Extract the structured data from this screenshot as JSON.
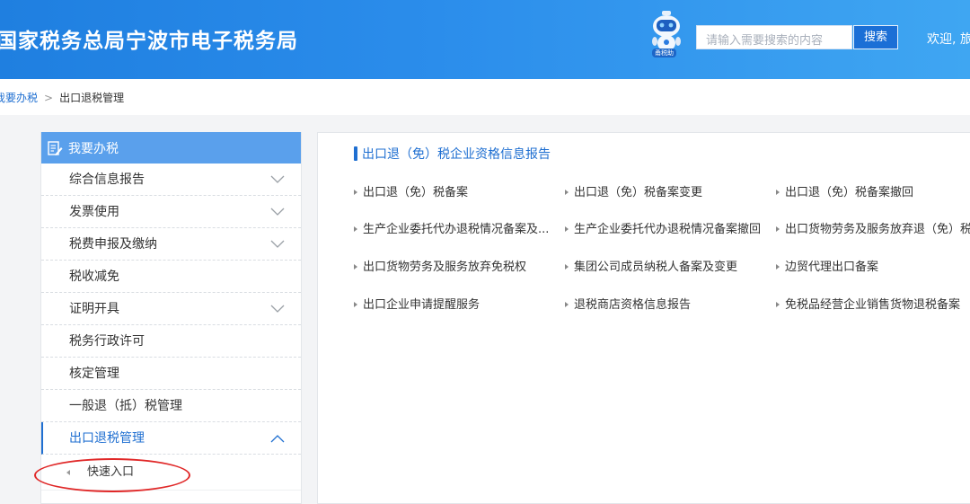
{
  "header": {
    "title": "国家税务总局宁波市电子税务局",
    "robot_caption": "甬税助",
    "search_placeholder": "请输入需要搜索的内容",
    "search_button": "搜索",
    "welcome": "欢迎, 旅"
  },
  "breadcrumb": {
    "home": "我要办税",
    "separator": ">",
    "current": "出口退税管理"
  },
  "sidebar": {
    "head": "我要办税",
    "items": [
      {
        "label": "综合信息报告",
        "chevron": "down"
      },
      {
        "label": "发票使用",
        "chevron": "down"
      },
      {
        "label": "税费申报及缴纳",
        "chevron": "down"
      },
      {
        "label": "税收减免",
        "chevron": ""
      },
      {
        "label": "证明开具",
        "chevron": "down"
      },
      {
        "label": "税务行政许可",
        "chevron": ""
      },
      {
        "label": "核定管理",
        "chevron": ""
      },
      {
        "label": "一般退（抵）税管理",
        "chevron": ""
      },
      {
        "label": "出口退税管理",
        "chevron": "up"
      }
    ],
    "sub_items": [
      {
        "label": "快速入口"
      }
    ]
  },
  "main": {
    "section_title": "出口退（免）税企业资格信息报告",
    "services": [
      [
        "出口退（免）税备案",
        "出口退（免）税备案变更",
        "出口退（免）税备案撤回"
      ],
      [
        "生产企业委托代办退税情况备案及...",
        "生产企业委托代办退税情况备案撤回",
        "出口货物劳务及服务放弃退（免）税"
      ],
      [
        "出口货物劳务及服务放弃免税权",
        "集团公司成员纳税人备案及变更",
        "边贸代理出口备案"
      ],
      [
        "出口企业申请提醒服务",
        "退税商店资格信息报告",
        "免税品经营企业销售货物退税备案"
      ]
    ]
  },
  "colors": {
    "header_blue": "#2b8deb",
    "accent_blue": "#1f6fd1",
    "sidebar_head": "#5aa0ec",
    "annotation_red": "#e02828"
  }
}
